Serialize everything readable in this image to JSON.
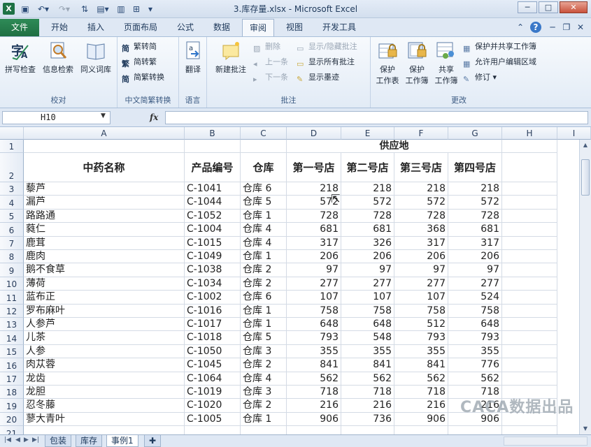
{
  "window": {
    "title": "3.库存量.xlsx - Microsoft Excel",
    "logo": "X"
  },
  "tabs": {
    "file": "文件",
    "items": [
      "开始",
      "插入",
      "页面布局",
      "公式",
      "数据",
      "审阅",
      "视图",
      "开发工具"
    ],
    "active": "审阅"
  },
  "ribbon": {
    "proofing": {
      "label": "校对",
      "spelling": "拼写检查",
      "research": "信息检索",
      "thesaurus": "同义词库"
    },
    "chinese": {
      "label": "中文简繁转换",
      "to_simplified": "繁转简",
      "to_traditional": "简转繁",
      "convert": "简繁转换"
    },
    "language": {
      "label": "语言",
      "translate": "翻译"
    },
    "comments": {
      "label": "批注",
      "new": "新建批注",
      "delete": "删除",
      "previous": "上一条",
      "next": "下一条",
      "show_hide": "显示/隐藏批注",
      "show_all": "显示所有批注",
      "show_ink": "显示墨迹"
    },
    "changes": {
      "label": "更改",
      "protect_sheet_1": "保护",
      "protect_sheet_2": "工作表",
      "protect_book_1": "保护",
      "protect_book_2": "工作簿",
      "share_book_1": "共享",
      "share_book_2": "工作簿",
      "protect_share": "保护并共享工作簿",
      "allow_edit": "允许用户编辑区域",
      "track": "修订"
    }
  },
  "formula_bar": {
    "name_box": "H10",
    "fx": "fx",
    "formula": ""
  },
  "sheet": {
    "columns": [
      "A",
      "B",
      "C",
      "D",
      "E",
      "F",
      "G",
      "H",
      "I"
    ],
    "supply_header": "供应地",
    "headers": [
      "中药名称",
      "产品编号",
      "仓库",
      "第一号店",
      "第二号店",
      "第三号店",
      "第四号店"
    ],
    "rows": [
      {
        "n": "3",
        "name": "藜芦",
        "code": "C-1041",
        "wh": "仓库 6",
        "d": "218",
        "e": "218",
        "f": "218",
        "g": "218"
      },
      {
        "n": "4",
        "name": "漏芦",
        "code": "C-1044",
        "wh": "仓库 5",
        "d": "572",
        "e": "572",
        "f": "572",
        "g": "572"
      },
      {
        "n": "5",
        "name": "路路通",
        "code": "C-1052",
        "wh": "仓库 1",
        "d": "728",
        "e": "728",
        "f": "728",
        "g": "728"
      },
      {
        "n": "6",
        "name": "蕤仁",
        "code": "C-1004",
        "wh": "仓库 4",
        "d": "681",
        "e": "681",
        "f": "368",
        "g": "681"
      },
      {
        "n": "7",
        "name": "鹿茸",
        "code": "C-1015",
        "wh": "仓库 4",
        "d": "317",
        "e": "326",
        "f": "317",
        "g": "317"
      },
      {
        "n": "8",
        "name": "鹿肉",
        "code": "C-1049",
        "wh": "仓库 1",
        "d": "206",
        "e": "206",
        "f": "206",
        "g": "206"
      },
      {
        "n": "9",
        "name": "鹅不食草",
        "code": "C-1038",
        "wh": "仓库 2",
        "d": "97",
        "e": "97",
        "f": "97",
        "g": "97"
      },
      {
        "n": "10",
        "name": "薄荷",
        "code": "C-1034",
        "wh": "仓库 2",
        "d": "277",
        "e": "277",
        "f": "277",
        "g": "277"
      },
      {
        "n": "11",
        "name": "蓝布正",
        "code": "C-1002",
        "wh": "仓库 6",
        "d": "107",
        "e": "107",
        "f": "107",
        "g": "524"
      },
      {
        "n": "12",
        "name": "罗布麻叶",
        "code": "C-1016",
        "wh": "仓库 1",
        "d": "758",
        "e": "758",
        "f": "758",
        "g": "758"
      },
      {
        "n": "13",
        "name": "人参芦",
        "code": "C-1017",
        "wh": "仓库 1",
        "d": "648",
        "e": "648",
        "f": "512",
        "g": "648"
      },
      {
        "n": "14",
        "name": "儿茶",
        "code": "C-1018",
        "wh": "仓库 5",
        "d": "793",
        "e": "548",
        "f": "793",
        "g": "793"
      },
      {
        "n": "15",
        "name": "人参",
        "code": "C-1050",
        "wh": "仓库 3",
        "d": "355",
        "e": "355",
        "f": "355",
        "g": "355"
      },
      {
        "n": "16",
        "name": "肉苁蓉",
        "code": "C-1045",
        "wh": "仓库 2",
        "d": "841",
        "e": "841",
        "f": "841",
        "g": "776"
      },
      {
        "n": "17",
        "name": "龙齿",
        "code": "C-1064",
        "wh": "仓库 4",
        "d": "562",
        "e": "562",
        "f": "562",
        "g": "562"
      },
      {
        "n": "18",
        "name": "龙胆",
        "code": "C-1019",
        "wh": "仓库 3",
        "d": "718",
        "e": "718",
        "f": "718",
        "g": "718"
      },
      {
        "n": "19",
        "name": "忍冬藤",
        "code": "C-1020",
        "wh": "仓库 2",
        "d": "216",
        "e": "216",
        "f": "216",
        "g": "216"
      },
      {
        "n": "20",
        "name": "蓼大青叶",
        "code": "C-1005",
        "wh": "仓库 1",
        "d": "906",
        "e": "736",
        "f": "906",
        "g": "906"
      },
      {
        "n": "21",
        "name": "",
        "code": "",
        "wh": "",
        "d": "",
        "e": "",
        "f": "",
        "g": ""
      }
    ]
  },
  "sheet_tabs": [
    "包装",
    "库存",
    "事例1"
  ],
  "active_sheet": "事例1",
  "watermark": "CACA数据出品",
  "colors": {
    "file_tab": "#1f6f43",
    "accent": "#2a4a76"
  }
}
